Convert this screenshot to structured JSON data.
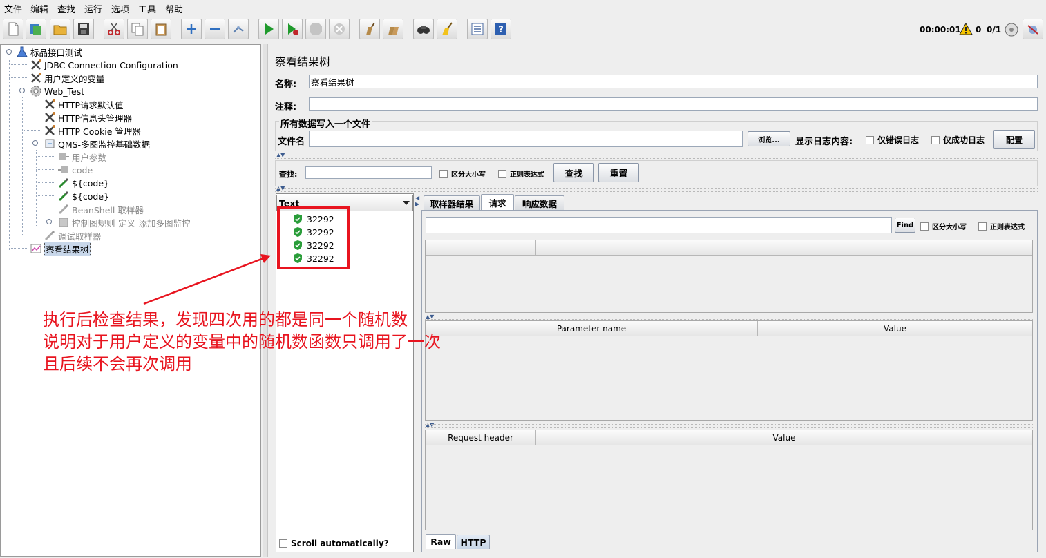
{
  "menu": [
    "文件",
    "编辑",
    "查找",
    "运行",
    "选项",
    "工具",
    "帮助"
  ],
  "toolbar": {
    "timer": "00:00:01",
    "warnings": "0",
    "threads": "0/1",
    "buttons": [
      "new-icon",
      "templates-icon",
      "open-icon",
      "save-icon",
      "cut-icon",
      "copy-icon",
      "paste-icon",
      "expand-icon",
      "collapse-icon",
      "toggle-icon",
      "start-icon",
      "start-no-pause-icon",
      "stop-icon",
      "shutdown-icon",
      "clear-icon",
      "clear-all-icon",
      "search-icon",
      "reset-search-icon",
      "function-helper-icon",
      "help-icon"
    ]
  },
  "tree": {
    "root": "标品接口测试",
    "jdbc": "JDBC Connection Configuration",
    "user_vars": "用户定义的变量",
    "thread_group": "Web_Test",
    "http_defaults": "HTTP请求默认值",
    "header_manager": "HTTP信息头管理器",
    "cookie_manager": "HTTP Cookie 管理器",
    "qms": "QMS-多图监控基础数据",
    "user_params": "用户参数",
    "code": "code",
    "code_var1": "${code}",
    "code_var2": "${code}",
    "beanshell": "BeanShell 取样器",
    "controller": "控制图规则-定义-添加多图监控",
    "debug": "调试取样器",
    "result_tree": "察看结果树"
  },
  "panel": {
    "title": "察看结果树",
    "name_label": "名称:",
    "name_value": "察看结果树",
    "comment_label": "注释:",
    "comment_value": "",
    "file_group": "所有数据写入一个文件",
    "filename_label": "文件名",
    "filename_value": "",
    "browse": "浏览...",
    "log_label": "显示日志内容:",
    "errors_only": "仅错误日志",
    "success_only": "仅成功日志",
    "configure": "配置",
    "search_label": "查找:",
    "search_value": "",
    "case_sensitive": "区分大小写",
    "regex": "正则表达式",
    "search_btn": "查找",
    "reset_btn": "重置"
  },
  "results": {
    "renderer": "Text",
    "items": [
      "32292",
      "32292",
      "32292",
      "32292"
    ],
    "scroll_auto": "Scroll automatically?"
  },
  "detail": {
    "tabs": [
      "取样器结果",
      "请求",
      "响应数据"
    ],
    "active_tab": "请求",
    "find_btn": "Find",
    "case_sensitive": "区分大小写",
    "regex": "正则表达式",
    "param_name": "Parameter name",
    "param_value": "Value",
    "req_header": "Request header",
    "req_value": "Value",
    "bottom_tabs": [
      "Raw",
      "HTTP"
    ]
  },
  "annotation": {
    "line1": "执行后检查结果，发现四次用的都是同一个随机数",
    "line2": "说明对于用户定义的变量中的随机数函数只调用了一次",
    "line3": "且后续不会再次调用"
  },
  "colors": {
    "annotation_red": "#e8141f",
    "success_green": "#2a9d3a"
  }
}
